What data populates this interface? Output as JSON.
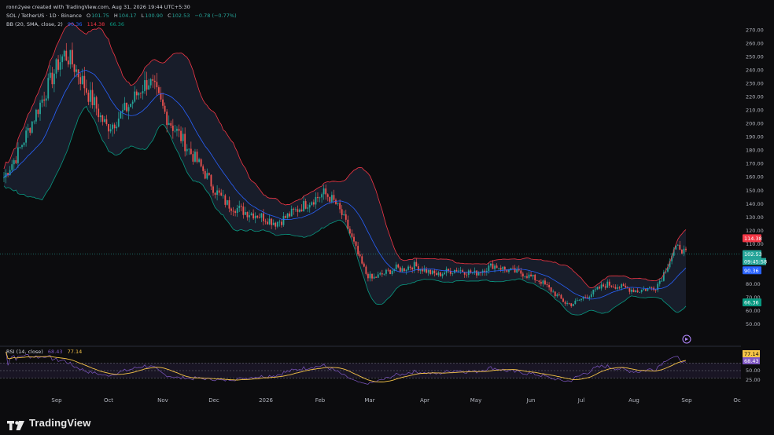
{
  "header": {
    "created_by": "ronn2yee created with TradingView.com, Aug 31, 2026 19:44 UTC+5:30",
    "symbol": "SOL / TetherUS · 1D · Binance",
    "ohlc": {
      "o_label": "O",
      "o": "101.75",
      "h_label": "H",
      "h": "104.17",
      "l_label": "L",
      "l": "100.90",
      "c_label": "C",
      "c": "102.53",
      "change": "−0.78 (−0.77%)"
    },
    "bb": {
      "label": "BB (20, SMA, close, 2)",
      "basis": "90.36",
      "upper": "114.38",
      "lower": "66.36"
    },
    "rsi": {
      "label": "RSI (14, close)",
      "rsi": "68.43",
      "ma": "77.14"
    }
  },
  "colors": {
    "background": "#0c0c0e",
    "up": "#26a69a",
    "down": "#ef5350",
    "bb_upper": "#f23645",
    "bb_lower": "#089981",
    "bb_basis": "#2962ff",
    "rsi_line": "#7e57c2",
    "rsi_ma": "#f7c548",
    "price_line": "#26a69a"
  },
  "chart_data": {
    "type": "candlestick",
    "symbol": "SOL / TetherUS",
    "timeframe": "1D",
    "x_labels": [
      "Sep",
      "Oct",
      "Nov",
      "Dec",
      "2026",
      "Feb",
      "Mar",
      "Apr",
      "May",
      "Jun",
      "Jul",
      "Aug",
      "Sep",
      "Oc"
    ],
    "y_ticks": [
      270,
      260,
      250,
      240,
      230,
      220,
      210,
      200,
      190,
      180,
      170,
      160,
      150,
      140,
      130,
      120,
      110,
      80,
      70,
      60,
      50
    ],
    "ylim": [
      40,
      275
    ],
    "price_close_trajectory": [
      160,
      168,
      175,
      185,
      195,
      205,
      215,
      225,
      235,
      245,
      252,
      248,
      240,
      232,
      222,
      215,
      205,
      198,
      200,
      205,
      210,
      215,
      222,
      228,
      232,
      225,
      215,
      205,
      198,
      192,
      185,
      178,
      172,
      165,
      158,
      150,
      145,
      140,
      138,
      136,
      134,
      133,
      132,
      130,
      128,
      126,
      128,
      131,
      134,
      137,
      140,
      143,
      145,
      148,
      145,
      140,
      132,
      122,
      110,
      98,
      88,
      84,
      86,
      88,
      90,
      92,
      91,
      93,
      94,
      92,
      90,
      88,
      87,
      89,
      90,
      91,
      90,
      89,
      88,
      90,
      92,
      94,
      93,
      91,
      90,
      89,
      88,
      86,
      84,
      82,
      78,
      74,
      70,
      66,
      65,
      67,
      70,
      72,
      75,
      78,
      80,
      79,
      78,
      77,
      76,
      75,
      76,
      77,
      78,
      85,
      95,
      105,
      108,
      102.53
    ],
    "bb_upper": "114.38",
    "bb_basis": "90.36",
    "bb_lower": "66.36",
    "last_price": "102.53",
    "countdown": "09:45:58",
    "rsi_ticks": [
      "50.00",
      "25.00"
    ],
    "rsi_value": "68.43",
    "rsi_ma": "77.14"
  },
  "footer": {
    "brand": "TradingView"
  }
}
